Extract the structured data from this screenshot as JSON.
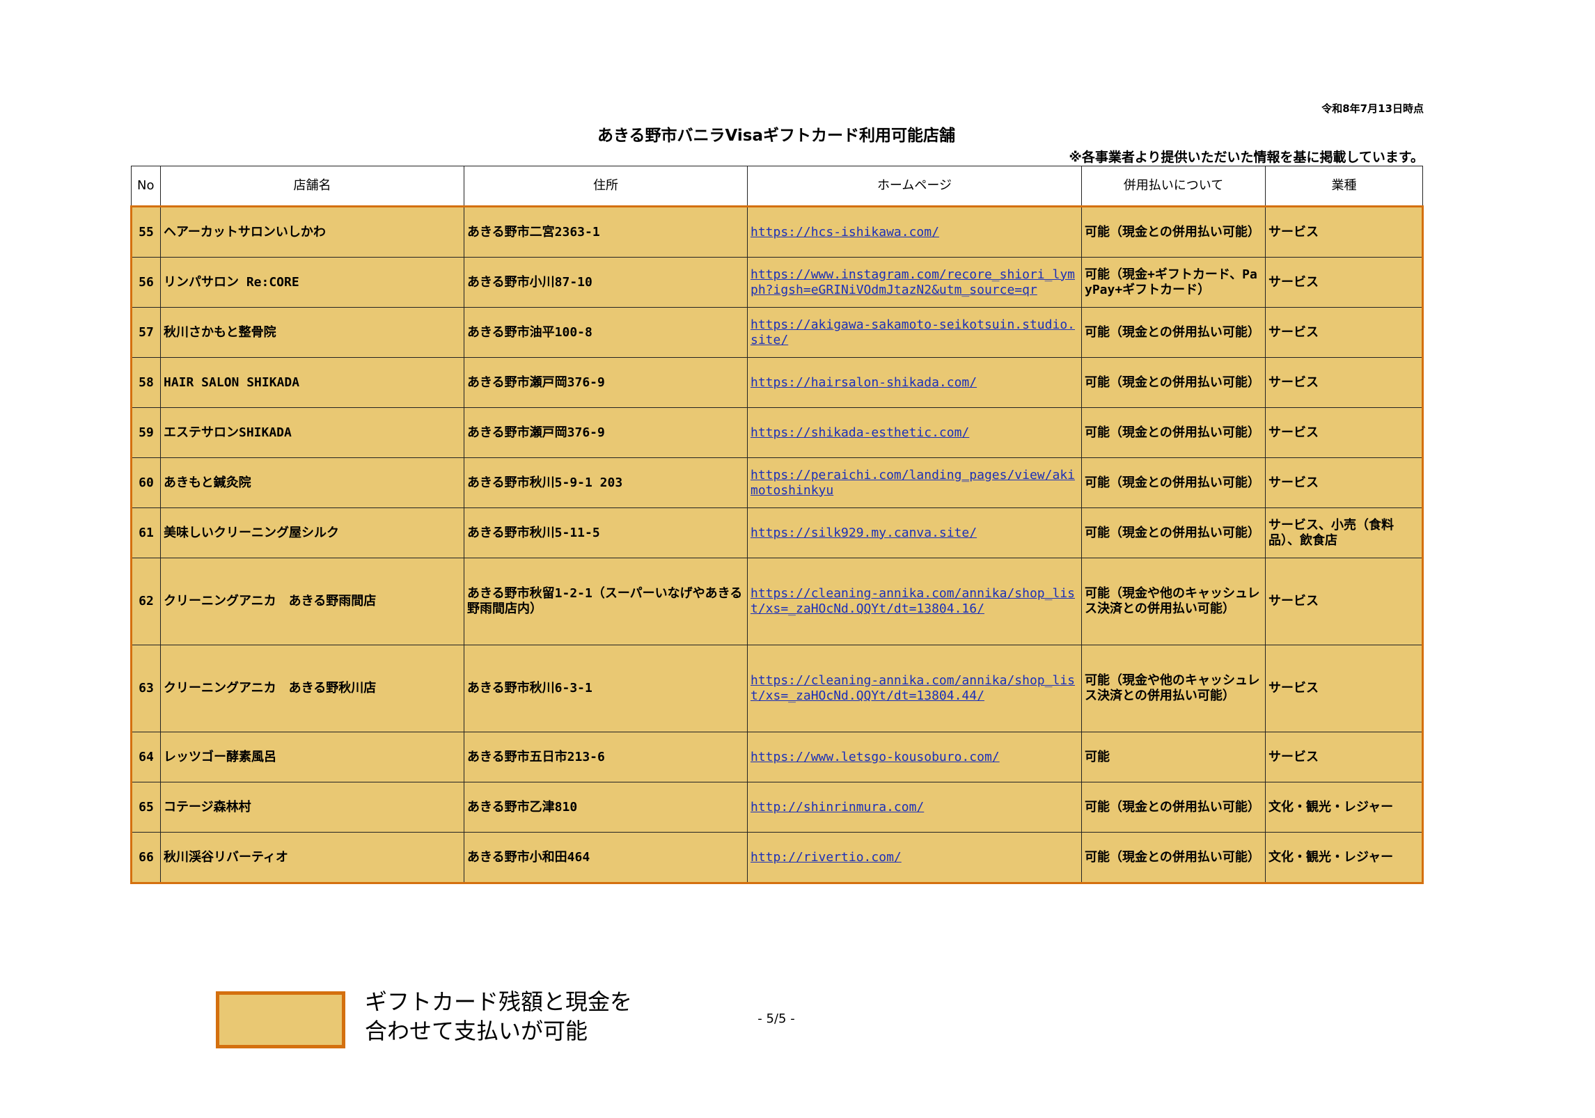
{
  "as_of": "令和8年7月13日時点",
  "title": "あきる野市バニラVisaギフトカード利用可能店舗",
  "note": "※各事業者より提供いただいた情報を基に掲載しています。",
  "table": {
    "headers": [
      "No",
      "店舗名",
      "住所",
      "ホームページ",
      "併用払いについて",
      "業種"
    ],
    "rows": [
      {
        "no": "55",
        "name": "ヘアーカットサロンいしかわ",
        "address": "あきる野市二宮2363-1",
        "hp": "https://hcs-ishikawa.com/",
        "combined": "可能（現金との併用払い可能）",
        "category": "サービス"
      },
      {
        "no": "56",
        "name": "リンパサロン Re:CORE",
        "address": "あきる野市小川87-10",
        "hp": "https://www.instagram.com/recore_shiori_lymph?igsh=eGRINiVOdmJtazN2&utm_source=qr",
        "combined": "可能（現金+ギフトカード、PayPay+ギフトカード）",
        "category": "サービス"
      },
      {
        "no": "57",
        "name": "秋川さかもと整骨院",
        "address": "あきる野市油平100-8",
        "hp": "https://akigawa-sakamoto-seikotsuin.studio.site/",
        "combined": "可能（現金との併用払い可能）",
        "category": "サービス"
      },
      {
        "no": "58",
        "name": "HAIR SALON SHIKADA",
        "address": "あきる野市瀬戸岡376-9",
        "hp": "https://hairsalon-shikada.com/",
        "combined": "可能（現金との併用払い可能）",
        "category": "サービス"
      },
      {
        "no": "59",
        "name": "エステサロンSHIKADA",
        "address": "あきる野市瀬戸岡376-9",
        "hp": "https://shikada-esthetic.com/",
        "combined": "可能（現金との併用払い可能）",
        "category": "サービス"
      },
      {
        "no": "60",
        "name": "あきもと鍼灸院",
        "address": "あきる野市秋川5-9-1 203",
        "hp": "https://peraichi.com/landing_pages/view/akimotoshinkyu",
        "combined": "可能（現金との併用払い可能）",
        "category": "サービス"
      },
      {
        "no": "61",
        "name": "美味しいクリーニング屋シルク",
        "address": "あきる野市秋川5-11-5",
        "hp": "https://silk929.my.canva.site/",
        "combined": "可能（現金との併用払い可能）",
        "category": "サービス、小売（食料品）、飲食店"
      },
      {
        "no": "62",
        "name": "クリーニングアニカ　あきる野雨間店",
        "address": "あきる野市秋留1-2-1（スーパーいなげやあきる野雨間店内）",
        "hp": "https://cleaning-annika.com/annika/shop_list/xs=_zaHOcNd.QQYt/dt=13804.16/",
        "combined": "可能（現金や他のキャッシュレス決済との併用払い可能）",
        "category": "サービス"
      },
      {
        "no": "63",
        "name": "クリーニングアニカ　あきる野秋川店",
        "address": "あきる野市秋川6-3-1",
        "hp": "https://cleaning-annika.com/annika/shop_list/xs=_zaHOcNd.QQYt/dt=13804.44/",
        "combined": "可能（現金や他のキャッシュレス決済との併用払い可能）",
        "category": "サービス"
      },
      {
        "no": "64",
        "name": "レッツゴー酵素風呂",
        "address": "あきる野市五日市213-6",
        "hp": "https://www.letsgo-kousoburo.com/",
        "combined": "可能",
        "category": "サービス"
      },
      {
        "no": "65",
        "name": "コテージ森林村",
        "address": "あきる野市乙津810",
        "hp": "http://shinrinmura.com/",
        "combined": "可能（現金との併用払い可能）",
        "category": "文化・観光・レジャー"
      },
      {
        "no": "66",
        "name": "秋川渓谷リバーティオ",
        "address": "あきる野市小和田464",
        "hp": "http://rivertio.com/",
        "combined": "可能（現金との併用払い可能）",
        "category": "文化・観光・レジャー"
      }
    ]
  },
  "legend": {
    "line1": "ギフトカード残額と現金を",
    "line2": "合わせて支払いが可能",
    "fill_color": "#e9c873",
    "border_color": "#d4700f"
  },
  "page_number": "- 5/5 -"
}
